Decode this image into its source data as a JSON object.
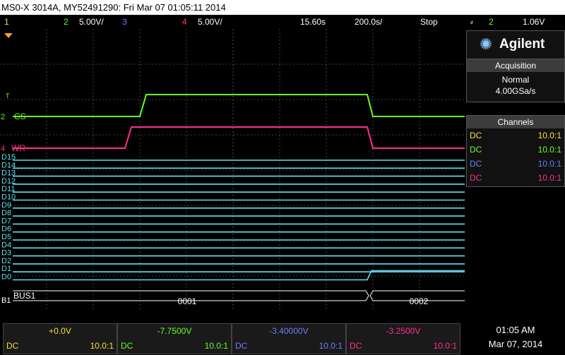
{
  "title": "MS0-X 3014A, MY52491290: Fri Mar 07 01:05:11 2014",
  "status": {
    "ch1_num": "1",
    "ch2_num": "2",
    "ch2_scale": "5.00V/",
    "ch3_num": "3",
    "ch4_num": "4",
    "ch4_scale": "5.00V/",
    "delay": "15.60s",
    "timebase": "200.0s/",
    "run_state": "Stop",
    "trig_symbol": "⸗",
    "trig_ch": "2",
    "trig_level": "1.06V"
  },
  "colors": {
    "ch1": "#f0e040",
    "ch2": "#66ff22",
    "ch3": "#6f7cff",
    "ch4": "#ff2f8e",
    "digital": "#5fe0f0",
    "grid": "#555555"
  },
  "traces": {
    "cs_label": "CS",
    "wr_label": "WR",
    "cs_marker": "2",
    "wr_marker": "4",
    "trigger_marker": "T"
  },
  "digital_labels": [
    "D15",
    "D14",
    "D13",
    "D12",
    "D11",
    "D10",
    "D9",
    "D8",
    "D7",
    "D6",
    "D5",
    "D4",
    "D3",
    "D2",
    "D1",
    "D0"
  ],
  "bus": {
    "label": "BUS1",
    "marker": "B1",
    "value_1": "0001",
    "value_2": "0002"
  },
  "brand": {
    "name": "Agilent"
  },
  "acquisition": {
    "header": "Acquisition",
    "mode": "Normal",
    "rate": "4.00GSa/s"
  },
  "channels": {
    "header": "Channels",
    "rows": [
      {
        "coupling": "DC",
        "probe": "10.0:1",
        "color": "#f0e040"
      },
      {
        "coupling": "DC",
        "probe": "10.0:1",
        "color": "#66ff22"
      },
      {
        "coupling": "DC",
        "probe": "10.0:1",
        "color": "#6f7cff"
      },
      {
        "coupling": "DC",
        "probe": "10.0:1",
        "color": "#ff2f8e"
      }
    ]
  },
  "bottom_channels": [
    {
      "offset": "+0.0V",
      "coupling": "DC",
      "probe": "10.0:1",
      "color": "#f0e040"
    },
    {
      "offset": "-7.7500V",
      "coupling": "DC",
      "probe": "10.0:1",
      "color": "#66ff22"
    },
    {
      "offset": "-3.40000V",
      "coupling": "DC",
      "probe": "10.0:1",
      "color": "#6f7cff"
    },
    {
      "offset": "-3.2500V",
      "coupling": "DC",
      "probe": "10.0:1",
      "color": "#ff2f8e"
    }
  ],
  "clock": {
    "time": "01:05 AM",
    "date": "Mar 07, 2014"
  }
}
